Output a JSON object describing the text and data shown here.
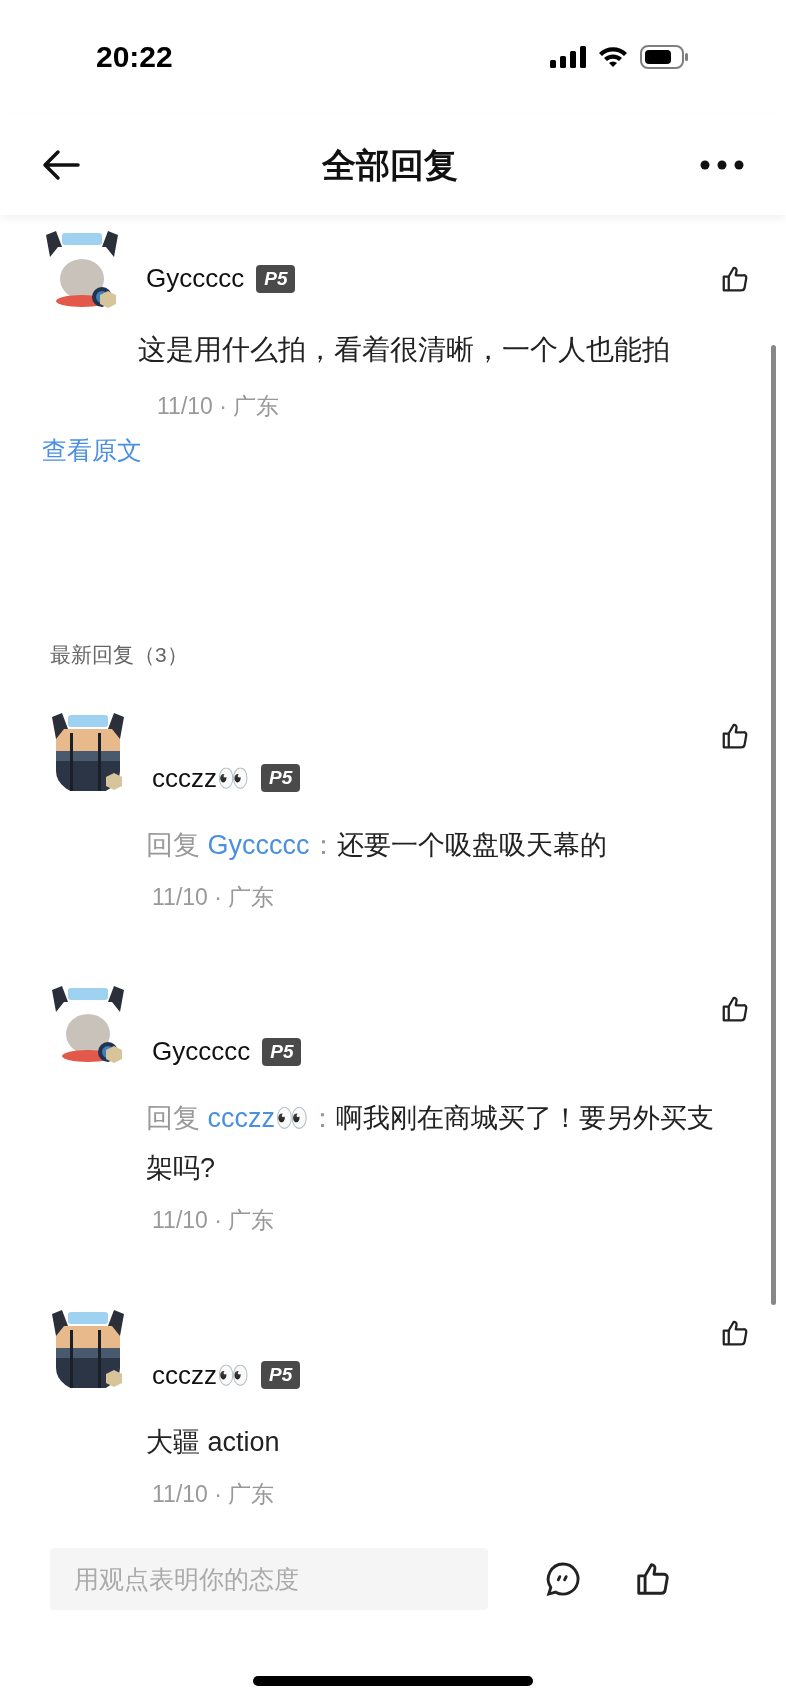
{
  "status_bar": {
    "time": "20:22"
  },
  "header": {
    "title": "全部回复"
  },
  "comment": {
    "author": "Gyccccc",
    "badge": "P5",
    "text": "这是用什么拍，看着很清晰，一个人也能拍",
    "meta": "11/10 · 广东",
    "link": "查看原文",
    "avatar": {
      "kind": "cat"
    }
  },
  "replies_heading": "最新回复（3）",
  "replies": [
    {
      "author": "ccczz👀",
      "badge": "P5",
      "avatar": {
        "kind": "lake"
      },
      "reply_prefix": "回复",
      "reply_to": "Gyccccc",
      "separator": "：",
      "text": "还要一个吸盘吸天幕的",
      "meta": "11/10 · 广东"
    },
    {
      "author": "Gyccccc",
      "badge": "P5",
      "avatar": {
        "kind": "cat"
      },
      "reply_prefix": "回复",
      "reply_to": "ccczz👀",
      "separator": "：",
      "text": "啊我刚在商城买了！要另外买支架吗?",
      "meta": "11/10 · 广东"
    },
    {
      "author": "ccczz👀",
      "badge": "P5",
      "avatar": {
        "kind": "lake"
      },
      "text": "大疆 action",
      "meta": "11/10 · 广东"
    }
  ],
  "composer": {
    "placeholder": "用观点表明你的态度"
  }
}
